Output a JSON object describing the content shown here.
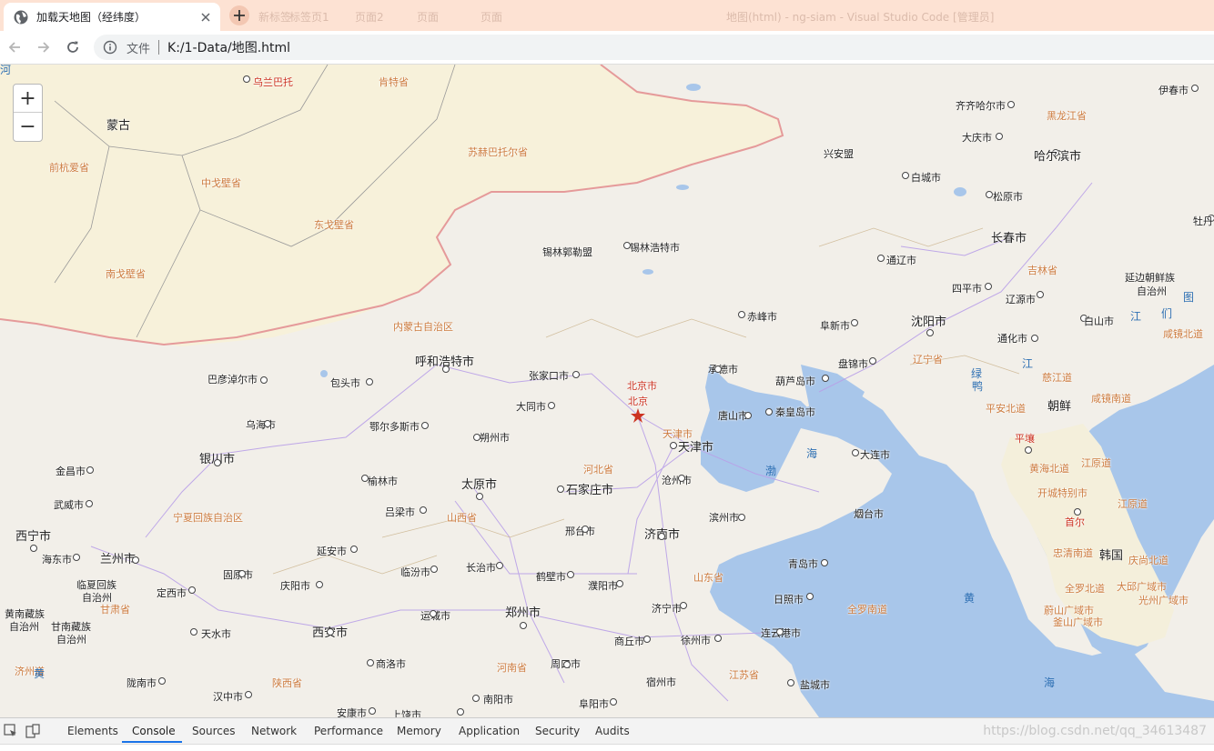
{
  "browser": {
    "tab_title": "加载天地图（经纬度）",
    "background_tabs": [
      "新标签",
      "标签页1",
      "页面2",
      "页面",
      "地图(html) - ng-siam - Visual Studio Code [管理员]"
    ],
    "address": {
      "scheme_label": "文件",
      "url": "K:/1-Data/地图.html"
    }
  },
  "map": {
    "zoom_in_label": "+",
    "zoom_out_label": "−",
    "labels": [
      {
        "text": "乌兰巴托",
        "cls": "prov red",
        "dot": true
      },
      {
        "text": "肯特省",
        "cls": "prov"
      },
      {
        "text": "蒙古",
        "cls": "country"
      },
      {
        "text": "前杭爱省",
        "cls": "prov"
      },
      {
        "text": "中戈壁省",
        "cls": "prov"
      },
      {
        "text": "东戈壁省",
        "cls": "prov"
      },
      {
        "text": "苏赫巴托尔省",
        "cls": "prov"
      },
      {
        "text": "南戈壁省",
        "cls": "prov"
      },
      {
        "text": "锡林郭勒盟",
        "cls": ""
      },
      {
        "text": "锡林浩特市",
        "cls": "",
        "dot": true
      },
      {
        "text": "内蒙古自治区",
        "cls": "prov"
      },
      {
        "text": "呼和浩特市",
        "cls": "big",
        "dot": true
      },
      {
        "text": "巴彦淖尔市",
        "cls": "",
        "dot": true
      },
      {
        "text": "包头市",
        "cls": "",
        "dot": true
      },
      {
        "text": "张家口市",
        "cls": "",
        "dot": true
      },
      {
        "text": "北京市",
        "cls": "prov red"
      },
      {
        "text": "北京",
        "cls": "prov red"
      },
      {
        "text": "承德市",
        "cls": "",
        "dot": true
      },
      {
        "text": "大同市",
        "cls": "",
        "dot": true
      },
      {
        "text": "乌海市",
        "cls": "",
        "dot": true
      },
      {
        "text": "鄂尔多斯市",
        "cls": "",
        "dot": true
      },
      {
        "text": "朔州市",
        "cls": "",
        "dot": true
      },
      {
        "text": "天津市",
        "cls": "prov"
      },
      {
        "text": "天津市",
        "cls": "big",
        "dot": true
      },
      {
        "text": "唐山市",
        "cls": "",
        "dot": true
      },
      {
        "text": "银川市",
        "cls": "big",
        "dot": true
      },
      {
        "text": "金昌市",
        "cls": "",
        "dot": true
      },
      {
        "text": "武威市",
        "cls": "",
        "dot": true
      },
      {
        "text": "榆林市",
        "cls": "",
        "dot": true
      },
      {
        "text": "太原市",
        "cls": "big",
        "dot": true
      },
      {
        "text": "石家庄市",
        "cls": "big",
        "dot": true
      },
      {
        "text": "河北省",
        "cls": "prov"
      },
      {
        "text": "沧州市",
        "cls": "",
        "dot": true
      },
      {
        "text": "宁夏回族自治区",
        "cls": "prov"
      },
      {
        "text": "吕梁市",
        "cls": "",
        "dot": true
      },
      {
        "text": "山西省",
        "cls": "prov"
      },
      {
        "text": "邢台市",
        "cls": "",
        "dot": true
      },
      {
        "text": "滨州市",
        "cls": "",
        "dot": true
      },
      {
        "text": "济南市",
        "cls": "big",
        "dot": true
      },
      {
        "text": "西宁市",
        "cls": "big",
        "dot": true
      },
      {
        "text": "海东市",
        "cls": "",
        "dot": true
      },
      {
        "text": "兰州市",
        "cls": "big",
        "dot": true
      },
      {
        "text": "延安市",
        "cls": "",
        "dot": true
      },
      {
        "text": "临汾市",
        "cls": "",
        "dot": true
      },
      {
        "text": "长治市",
        "cls": "",
        "dot": true
      },
      {
        "text": "鹤壁市",
        "cls": "",
        "dot": true
      },
      {
        "text": "山东省",
        "cls": "prov"
      },
      {
        "text": "青岛市",
        "cls": "",
        "dot": true
      },
      {
        "text": "临夏回族",
        "cls": ""
      },
      {
        "text": "自治州",
        "cls": ""
      },
      {
        "text": "固原市",
        "cls": "",
        "dot": true
      },
      {
        "text": "庆阳市",
        "cls": "",
        "dot": true
      },
      {
        "text": "濮阳市",
        "cls": "",
        "dot": true
      },
      {
        "text": "定西市",
        "cls": "",
        "dot": true
      },
      {
        "text": "甘肃省",
        "cls": "prov"
      },
      {
        "text": "济宁市",
        "cls": "",
        "dot": true
      },
      {
        "text": "日照市",
        "cls": "",
        "dot": true
      },
      {
        "text": "黄南藏族",
        "cls": ""
      },
      {
        "text": "自治州",
        "cls": ""
      },
      {
        "text": "甘南藏族",
        "cls": ""
      },
      {
        "text": "自治州",
        "cls": ""
      },
      {
        "text": "运城市",
        "cls": "",
        "dot": true
      },
      {
        "text": "郑州市",
        "cls": "big",
        "dot": true
      },
      {
        "text": "天水市",
        "cls": "",
        "dot": true
      },
      {
        "text": "西安市",
        "cls": "big",
        "dot": true
      },
      {
        "text": "商丘市",
        "cls": "",
        "dot": true
      },
      {
        "text": "徐州市",
        "cls": "",
        "dot": true
      },
      {
        "text": "连云港市",
        "cls": "",
        "dot": true
      },
      {
        "text": "商洛市",
        "cls": "",
        "dot": true
      },
      {
        "text": "河南省",
        "cls": "prov"
      },
      {
        "text": "周口市",
        "cls": "",
        "dot": true
      },
      {
        "text": "江苏省",
        "cls": "prov"
      },
      {
        "text": "陇南市",
        "cls": "",
        "dot": true
      },
      {
        "text": "陕西省",
        "cls": "prov"
      },
      {
        "text": "宿州市",
        "cls": "",
        "dot": true
      },
      {
        "text": "盐城市",
        "cls": "",
        "dot": true
      },
      {
        "text": "汉中市",
        "cls": "",
        "dot": true
      },
      {
        "text": "南阳市",
        "cls": "",
        "dot": true
      },
      {
        "text": "阜阳市",
        "cls": "",
        "dot": true
      },
      {
        "text": "安康市",
        "cls": "",
        "dot": true
      },
      {
        "text": "上饶市",
        "cls": "",
        "dot": true
      },
      {
        "text": "伊春市",
        "cls": "",
        "dot": true
      },
      {
        "text": "齐齐哈尔市",
        "cls": "",
        "dot": true
      },
      {
        "text": "黑龙江省",
        "cls": "prov"
      },
      {
        "text": "大庆市",
        "cls": "",
        "dot": true
      },
      {
        "text": "兴安盟",
        "cls": ""
      },
      {
        "text": "哈尔滨市",
        "cls": "big",
        "dot": true
      },
      {
        "text": "白城市",
        "cls": "",
        "dot": true
      },
      {
        "text": "松原市",
        "cls": "",
        "dot": true
      },
      {
        "text": "牡丹",
        "cls": "",
        "dot": true
      },
      {
        "text": "长春市",
        "cls": "big",
        "dot": true
      },
      {
        "text": "通辽市",
        "cls": "",
        "dot": true
      },
      {
        "text": "吉林省",
        "cls": "prov"
      },
      {
        "text": "延边朝鲜族",
        "cls": ""
      },
      {
        "text": "自治州",
        "cls": ""
      },
      {
        "text": "四平市",
        "cls": "",
        "dot": true
      },
      {
        "text": "辽源市",
        "cls": "",
        "dot": true
      },
      {
        "text": "图",
        "cls": "sea"
      },
      {
        "text": "赤峰市",
        "cls": "",
        "dot": true
      },
      {
        "text": "阜新市",
        "cls": "",
        "dot": true
      },
      {
        "text": "沈阳市",
        "cls": "big",
        "dot": true
      },
      {
        "text": "白山市",
        "cls": "",
        "dot": true
      },
      {
        "text": "江",
        "cls": "sea"
      },
      {
        "text": "们",
        "cls": "sea"
      },
      {
        "text": "通化市",
        "cls": "",
        "dot": true
      },
      {
        "text": "咸镜北道",
        "cls": "prov"
      },
      {
        "text": "辽宁省",
        "cls": "prov"
      },
      {
        "text": "江",
        "cls": "sea"
      },
      {
        "text": "盘锦市",
        "cls": "",
        "dot": true
      },
      {
        "text": "葫芦岛市",
        "cls": "",
        "dot": true
      },
      {
        "text": "绿",
        "cls": "sea"
      },
      {
        "text": "慈江道",
        "cls": "prov"
      },
      {
        "text": "鸭",
        "cls": "sea"
      },
      {
        "text": "咸镜南道",
        "cls": "prov"
      },
      {
        "text": "秦皇岛市",
        "cls": "",
        "dot": true
      },
      {
        "text": "平安北道",
        "cls": "prov"
      },
      {
        "text": "朝鲜",
        "cls": "country"
      },
      {
        "text": "平壤",
        "cls": "prov red",
        "dot": true
      },
      {
        "text": "海",
        "cls": "sea"
      },
      {
        "text": "大连市",
        "cls": "",
        "dot": true
      },
      {
        "text": "渤",
        "cls": "sea"
      },
      {
        "text": "黄海北道",
        "cls": "prov"
      },
      {
        "text": "江原道",
        "cls": "prov"
      },
      {
        "text": "开城特别市",
        "cls": "prov"
      },
      {
        "text": "江原道",
        "cls": "prov"
      },
      {
        "text": "烟台市",
        "cls": "",
        "dot": true
      },
      {
        "text": "首尔",
        "cls": "prov red",
        "dot": true
      },
      {
        "text": "忠清南道",
        "cls": "prov"
      },
      {
        "text": "韩国",
        "cls": "country"
      },
      {
        "text": "庆尚北道",
        "cls": "prov"
      },
      {
        "text": "全罗北道",
        "cls": "prov"
      },
      {
        "text": "大邱广域市",
        "cls": "prov"
      },
      {
        "text": "蔚山广域市",
        "cls": "prov"
      },
      {
        "text": "光州广域市",
        "cls": "prov"
      },
      {
        "text": "釜山广域市",
        "cls": "prov"
      },
      {
        "text": "全罗南道",
        "cls": "prov"
      },
      {
        "text": "黄",
        "cls": "sea"
      },
      {
        "text": "海",
        "cls": "sea"
      },
      {
        "text": "济州道",
        "cls": "prov"
      },
      {
        "text": "黄",
        "cls": "sea"
      },
      {
        "text": "河",
        "cls": "sea"
      }
    ]
  },
  "devtools": {
    "tabs": [
      "Elements",
      "Console",
      "Sources",
      "Network",
      "Performance",
      "Memory",
      "Application",
      "Security",
      "Audits"
    ],
    "active_tab": "Console",
    "watermark": "https://blog.csdn.net/qq_34613487"
  }
}
